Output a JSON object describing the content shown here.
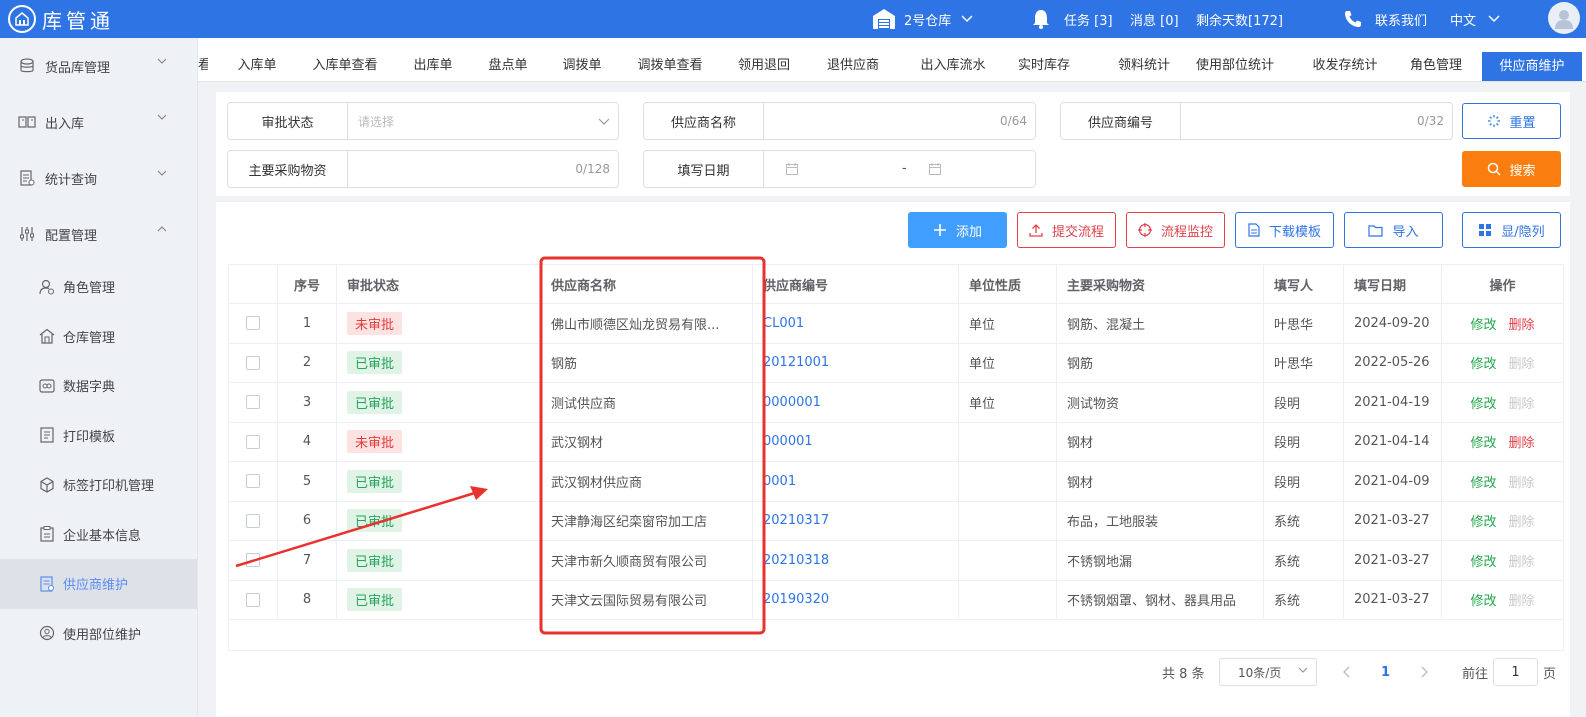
{
  "app": {
    "title": "库管通"
  },
  "topbar": {
    "warehouse": "2号仓库",
    "tasks": "任务 [3]",
    "messages": "消息 [0]",
    "days_left": "剩余天数[172]",
    "contact": "联系我们",
    "language": "中文"
  },
  "sidebar": {
    "groups": [
      {
        "label": "货品库管理"
      },
      {
        "label": "出入库"
      },
      {
        "label": "统计查询"
      },
      {
        "label": "配置管理"
      }
    ],
    "items": [
      {
        "label": "角色管理"
      },
      {
        "label": "仓库管理"
      },
      {
        "label": "数据字典"
      },
      {
        "label": "打印模板"
      },
      {
        "label": "标签打印机管理"
      },
      {
        "label": "企业基本信息"
      },
      {
        "label": "供应商维护"
      },
      {
        "label": "使用部位维护"
      }
    ]
  },
  "tabs": [
    "看",
    "入库单",
    "入库单查看",
    "出库单",
    "盘点单",
    "调拨单",
    "调拨单查看",
    "领用退回",
    "退供应商",
    "出入库流水",
    "实时库存",
    "领料统计",
    "使用部位统计",
    "收发存统计",
    "角色管理",
    "供应商维护"
  ],
  "filter": {
    "approval_label": "审批状态",
    "approval_placeholder": "请选择",
    "supplier_name_label": "供应商名称",
    "supplier_name_count": "0/64",
    "supplier_code_label": "供应商编号",
    "supplier_code_count": "0/32",
    "materials_label": "主要采购物资",
    "materials_count": "0/128",
    "date_label": "填写日期",
    "date_sep": "-",
    "reset": "重置",
    "search": "搜索"
  },
  "actions": {
    "add": "添加",
    "submit_flow": "提交流程",
    "monitor_flow": "流程监控",
    "download_template": "下载模板",
    "import": "导入",
    "toggle_columns": "显/隐列"
  },
  "table": {
    "headers": [
      "序号",
      "审批状态",
      "供应商名称",
      "供应商编号",
      "单位性质",
      "主要采购物资",
      "填写人",
      "填写日期",
      "操作"
    ],
    "edit_label": "修改",
    "delete_label": "删除",
    "rows": [
      {
        "no": "1",
        "status": "未审批",
        "name": "佛山市顺德区灿龙贸易有限...",
        "code": "CL001",
        "nature": "单位",
        "materials": "钢筋、混凝土",
        "person": "叶思华",
        "date": "2024-09-20",
        "deletable": true
      },
      {
        "no": "2",
        "status": "已审批",
        "name": "钢筋",
        "code": "20121001",
        "nature": "单位",
        "materials": "钢筋",
        "person": "叶思华",
        "date": "2022-05-26",
        "deletable": false
      },
      {
        "no": "3",
        "status": "已审批",
        "name": "测试供应商",
        "code": "0000001",
        "nature": "单位",
        "materials": "测试物资",
        "person": "段明",
        "date": "2021-04-19",
        "deletable": false
      },
      {
        "no": "4",
        "status": "未审批",
        "name": "武汉钢材",
        "code": "000001",
        "nature": "",
        "materials": "钢材",
        "person": "段明",
        "date": "2021-04-14",
        "deletable": true
      },
      {
        "no": "5",
        "status": "已审批",
        "name": "武汉钢材供应商",
        "code": "0001",
        "nature": "",
        "materials": "钢材",
        "person": "段明",
        "date": "2021-04-09",
        "deletable": false
      },
      {
        "no": "6",
        "status": "已审批",
        "name": "天津静海区纪栾窗帘加工店",
        "code": "20210317",
        "nature": "",
        "materials": "布品，工地服装",
        "person": "系统",
        "date": "2021-03-27",
        "deletable": false
      },
      {
        "no": "7",
        "status": "已审批",
        "name": "天津市新久顺商贸有限公司",
        "code": "20210318",
        "nature": "",
        "materials": "不锈钢地漏",
        "person": "系统",
        "date": "2021-03-27",
        "deletable": false
      },
      {
        "no": "8",
        "status": "已审批",
        "name": "天津文云国际贸易有限公司",
        "code": "20190320",
        "nature": "",
        "materials": "不锈钢烟罩、钢材、器具用品",
        "person": "系统",
        "date": "2021-03-27",
        "deletable": false
      }
    ]
  },
  "pagination": {
    "total": "共 8 条",
    "page_size": "10条/页",
    "current": "1",
    "goto_label": "前往",
    "goto_value": "1",
    "page_unit": "页"
  },
  "colors": {
    "primary": "#2f74e5",
    "orange": "#fa7d0f",
    "danger": "#e0414a",
    "success": "#21a64a",
    "annotation": "#e8322d"
  }
}
